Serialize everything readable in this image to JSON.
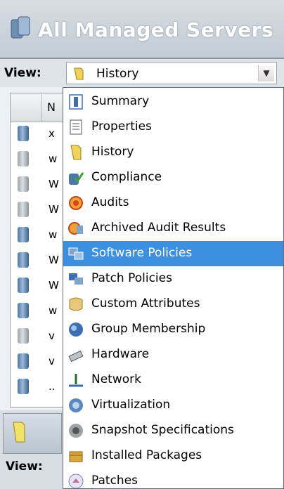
{
  "header": {
    "title": "All Managed Servers"
  },
  "view": {
    "label": "View:",
    "selected": "History"
  },
  "table": {
    "header_col": "N",
    "rows": [
      {
        "text": "x",
        "icon": "blue"
      },
      {
        "text": "w",
        "icon": "grey"
      },
      {
        "text": "W",
        "icon": "grey"
      },
      {
        "text": "W",
        "icon": "grey"
      },
      {
        "text": "w",
        "icon": "blue"
      },
      {
        "text": "W",
        "icon": "blue"
      },
      {
        "text": "W",
        "icon": "blue"
      },
      {
        "text": "w",
        "icon": "blue"
      },
      {
        "text": "v",
        "icon": "grey"
      },
      {
        "text": "v",
        "icon": "blue"
      },
      {
        "text": "..",
        "icon": "blue"
      }
    ]
  },
  "bottom": {
    "view_label": "View:"
  },
  "menu": {
    "items": [
      {
        "label": "Summary",
        "icon": "summary-icon"
      },
      {
        "label": "Properties",
        "icon": "properties-icon"
      },
      {
        "label": "History",
        "icon": "history-icon"
      },
      {
        "label": "Compliance",
        "icon": "compliance-icon"
      },
      {
        "label": "Audits",
        "icon": "audits-icon"
      },
      {
        "label": "Archived Audit Results",
        "icon": "archived-audit-icon"
      },
      {
        "label": "Software Policies",
        "icon": "software-policies-icon",
        "selected": true
      },
      {
        "label": "Patch Policies",
        "icon": "patch-policies-icon"
      },
      {
        "label": "Custom Attributes",
        "icon": "custom-attributes-icon"
      },
      {
        "label": "Group Membership",
        "icon": "group-membership-icon"
      },
      {
        "label": "Hardware",
        "icon": "hardware-icon"
      },
      {
        "label": "Network",
        "icon": "network-icon"
      },
      {
        "label": "Virtualization",
        "icon": "virtualization-icon"
      },
      {
        "label": "Snapshot Specifications",
        "icon": "snapshot-icon"
      },
      {
        "label": "Installed Packages",
        "icon": "installed-packages-icon"
      },
      {
        "label": "Patches",
        "icon": "patches-icon"
      }
    ]
  },
  "colors": {
    "selection": "#3d8fe0",
    "header_bg": "#c2cbd3"
  }
}
